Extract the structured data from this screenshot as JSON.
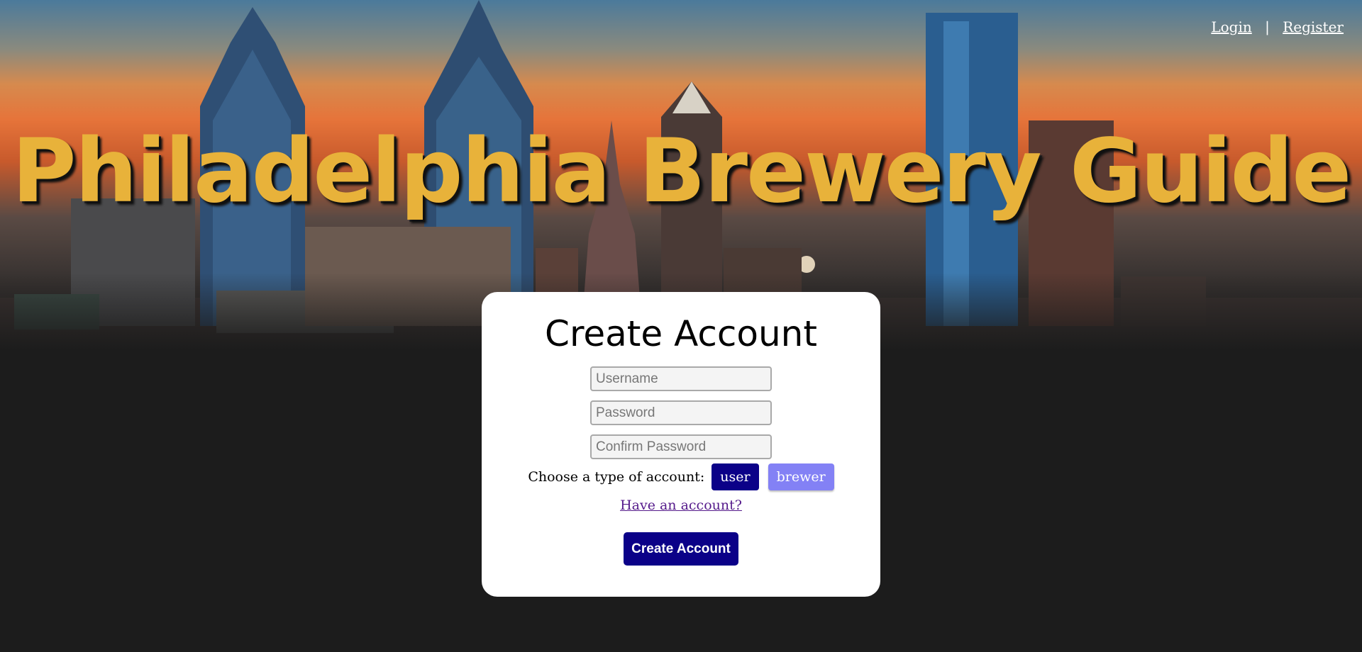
{
  "nav": {
    "login_label": "Login",
    "separator": "|",
    "register_label": "Register"
  },
  "hero": {
    "title": "Philadelphia Brewery Guide"
  },
  "form": {
    "heading": "Create Account",
    "username_placeholder": "Username",
    "password_placeholder": "Password",
    "confirm_placeholder": "Confirm Password",
    "account_type_label": "Choose a type of account:",
    "account_types": [
      {
        "label": "user",
        "selected": true
      },
      {
        "label": "brewer",
        "selected": false
      }
    ],
    "have_account_link": "Have an account?",
    "submit_label": "Create Account"
  },
  "colors": {
    "title": "#e8b23a",
    "primary_button": "#0b0188",
    "secondary_button": "#8381f5",
    "page_background": "#1c1c1c"
  }
}
